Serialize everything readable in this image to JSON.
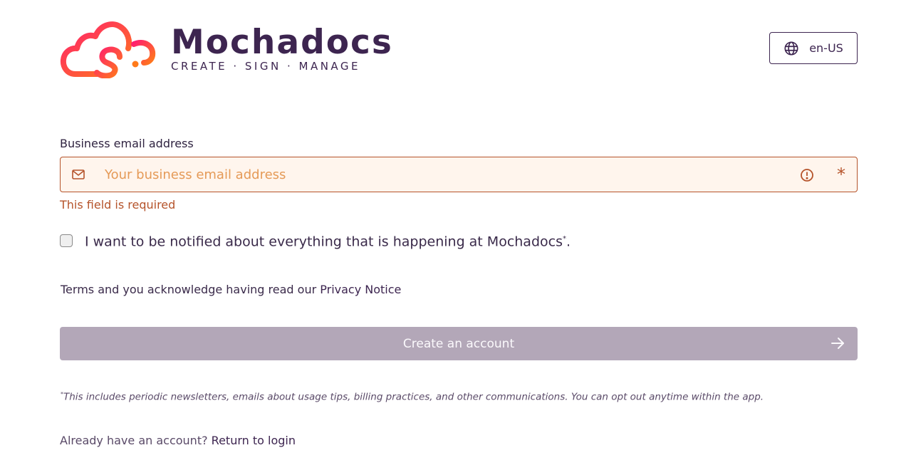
{
  "brand": {
    "name": "Mochadocs",
    "tagline": "CREATE · SIGN · MANAGE",
    "colors": {
      "gradient_start": "#ff1f6e",
      "gradient_end": "#ff7a1a",
      "wordmark": "#3d2550"
    }
  },
  "language": {
    "icon": "globe-icon",
    "value": "en-US"
  },
  "form": {
    "email": {
      "label": "Business email address",
      "placeholder": "Your business email address",
      "value": "",
      "icon": "mail-icon",
      "status_icon": "alert-circle-icon",
      "required_marker": "*",
      "error": "This field is required"
    },
    "newsletter": {
      "checked": false,
      "label": "I want to be notified about everything that is happening at Mochadocs",
      "sup": "*",
      "suffix": "."
    },
    "terms": {
      "text": "Terms and you acknowledge having read our ",
      "privacy_link": "Privacy Notice"
    },
    "submit": {
      "label": "Create an account",
      "icon": "arrow-right-icon",
      "enabled": false
    },
    "footnote": {
      "sup": "*",
      "text": "This includes periodic newsletters, emails about usage tips, billing practices, and other communications. You can opt out anytime within the app."
    },
    "login": {
      "prompt": "Already have an account? ",
      "link": "Return to login"
    }
  },
  "colors": {
    "error": "#b5532a",
    "input_bg": "#fff5ed",
    "button_disabled": "#b3a7b8"
  }
}
